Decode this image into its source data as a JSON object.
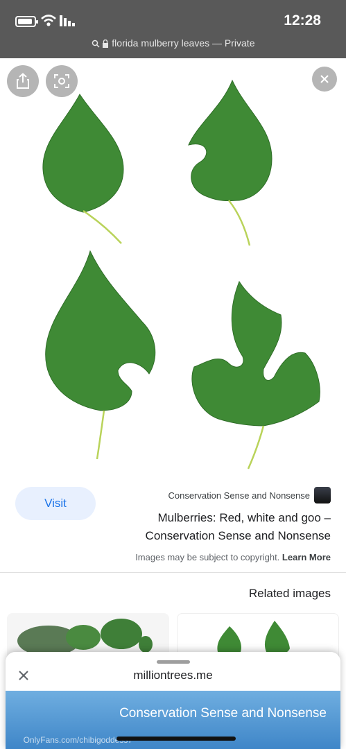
{
  "status": {
    "time": "12:28"
  },
  "address_bar": {
    "text": "florida mulberry leaves — Private"
  },
  "image_viewer": {
    "image_description_icons": [
      "share-icon",
      "lens-icon",
      "close-icon"
    ]
  },
  "result": {
    "source_name": "Conservation Sense and Nonsense",
    "visit_label": "Visit",
    "title": "Mulberries: Red, white and goo – Conservation Sense and Nonsense",
    "copyright_text": "Images may be subject to copyright.",
    "learn_more_label": "Learn More"
  },
  "related": {
    "heading": "Related images"
  },
  "sheet": {
    "domain": "milliontrees.me",
    "banner_text": "Conservation Sense and Nonsense",
    "watermark": "OnlyFans.com/chibigoddess7"
  },
  "colors": {
    "status_bar": "#595959",
    "visit_bg": "#e8f0fe",
    "visit_text": "#1a73e8",
    "leaf": "#3f8a35",
    "banner": "#4f95d2"
  }
}
